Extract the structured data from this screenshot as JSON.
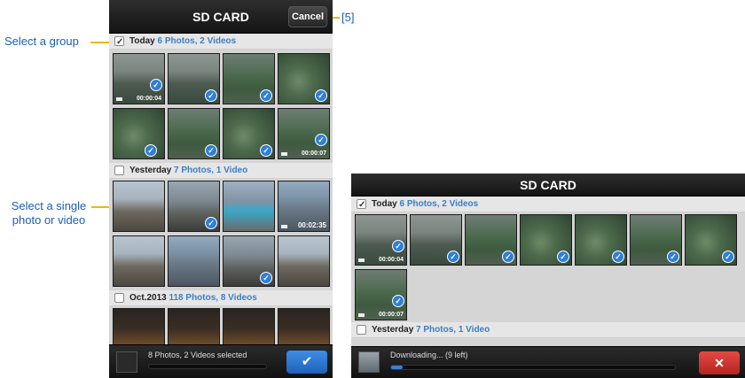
{
  "callouts": {
    "cancel_ref": "[5]",
    "select_group": "Select a group",
    "select_single_line1": "Select a single",
    "select_single_line2": "photo or video"
  },
  "screen_select": {
    "title": "SD CARD",
    "cancel_label": "Cancel",
    "groups": [
      {
        "title": "Today",
        "count": "6 Photos, 2 Videos",
        "checked": true
      },
      {
        "title": "Yesterday",
        "count": "7 Photos, 1 Video",
        "checked": false
      },
      {
        "title": "Oct.2013",
        "count": "118 Photos, 8 Videos",
        "checked": false
      }
    ],
    "durations": {
      "today_first": "00:00:04",
      "today_last": "00:00:07",
      "yesterday": "00:02:35"
    },
    "selection_status": "8 Photos, 2 Videos selected",
    "confirm_icon": "checkmark-icon",
    "colors": {
      "accent": "#2f7fd8",
      "count": "#3d7ec4"
    }
  },
  "screen_download": {
    "title": "SD CARD",
    "groups": [
      {
        "title": "Today",
        "count": "6 Photos, 2 Videos",
        "checked": true
      },
      {
        "title": "Yesterday",
        "count": "7 Photos, 1 Video",
        "checked": false
      }
    ],
    "durations": {
      "today_first": "00:00:04",
      "today_last": "00:00:07"
    },
    "status": "Downloading... (9 left)",
    "progress": 0.04,
    "stop_icon": "close-icon",
    "colors": {
      "stop": "#d3322d"
    }
  }
}
